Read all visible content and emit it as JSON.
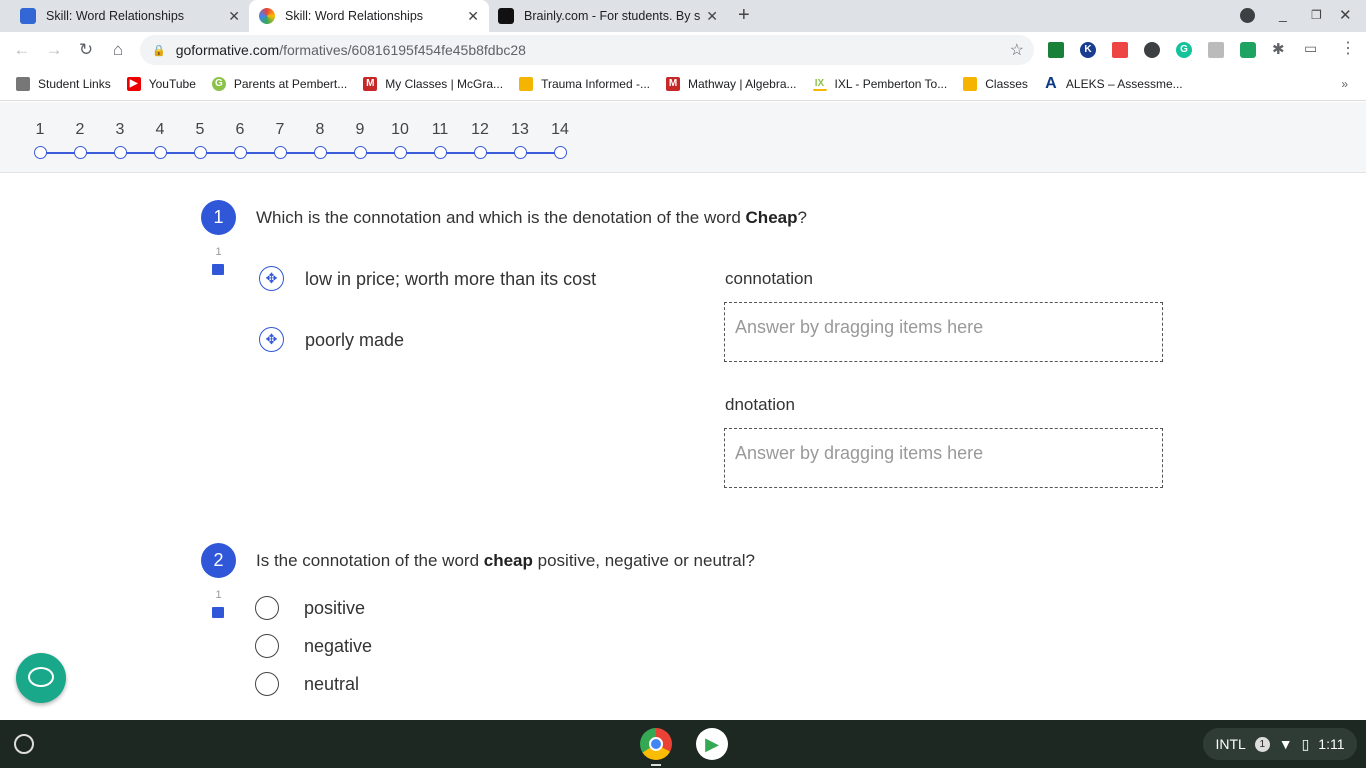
{
  "browser": {
    "tabs": [
      {
        "title": "Skill: Word Relationships",
        "active": false
      },
      {
        "title": "Skill: Word Relationships",
        "active": true
      },
      {
        "title": "Brainly.com - For students. By students.",
        "active": false
      }
    ],
    "url_domain": "goformative.com",
    "url_path": "/formatives/60816195f454fe45b8fdbc28",
    "bookmarks": [
      "Student Links",
      "YouTube",
      "Parents at Pembert...",
      "My Classes | McGra...",
      "Trauma Informed -...",
      "Mathway | Algebra...",
      "IXL - Pemberton To...",
      "Classes",
      "ALEKS – Assessme..."
    ],
    "more_bookmarks": "»"
  },
  "pager": {
    "numbers": [
      "1",
      "2",
      "3",
      "4",
      "5",
      "6",
      "7",
      "8",
      "9",
      "10",
      "11",
      "12",
      "13",
      "14"
    ]
  },
  "q1": {
    "number": "1",
    "text_before": "Which is the connotation and which is the denotation of the word ",
    "bold": "Cheap",
    "text_after": "?",
    "comment_count": "1",
    "items": [
      "low in price; worth more than its cost",
      "poorly made"
    ],
    "zones": [
      {
        "label": "connotation",
        "placeholder": "Answer by dragging items here"
      },
      {
        "label": "dnotation",
        "placeholder": "Answer by dragging items here"
      }
    ]
  },
  "q2": {
    "number": "2",
    "text_before": "Is the connotation of the word ",
    "bold": "cheap",
    "text_after": " positive, negative or neutral?",
    "comment_count": "1",
    "options": [
      "positive",
      "negative",
      "neutral"
    ]
  },
  "taskbar": {
    "keyboard": "INTL",
    "notifications": "1",
    "time": "1:11"
  },
  "colors": {
    "accent": "#2f57d8",
    "chat": "#1aa88a"
  }
}
